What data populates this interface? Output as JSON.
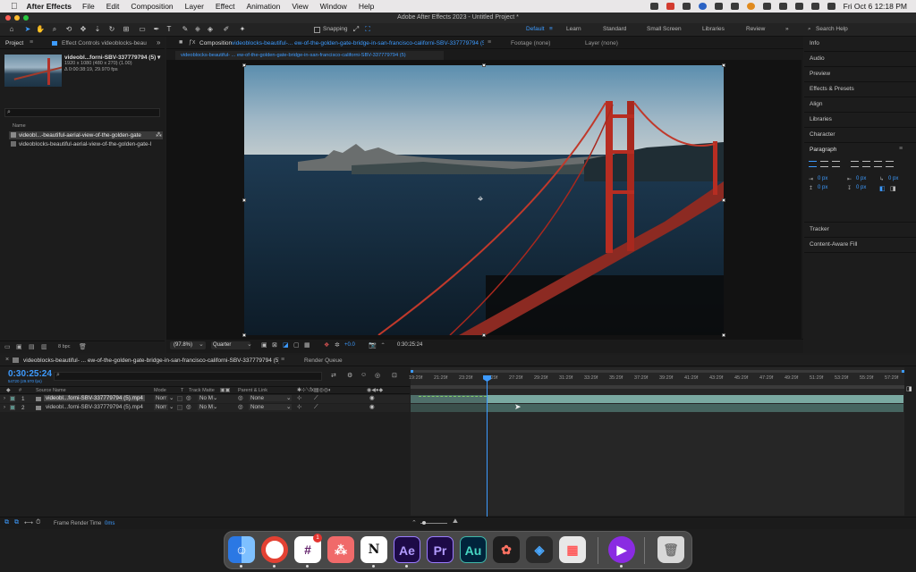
{
  "menubar": {
    "app_name": "After Effects",
    "items": [
      "File",
      "Edit",
      "Composition",
      "Layer",
      "Effect",
      "Animation",
      "View",
      "Window",
      "Help"
    ],
    "date_time": "Fri Oct 6  12:18 PM"
  },
  "window": {
    "title": "Adobe After Effects 2023 - Untitled Project *"
  },
  "toolbar": {
    "snapping_label": "Snapping",
    "workspaces": [
      "Default",
      "Learn",
      "Standard",
      "Small Screen",
      "Libraries",
      "Review"
    ],
    "active_workspace": "Default",
    "search_help_placeholder": "Search Help"
  },
  "project_panel": {
    "tab_project": "Project",
    "tab_effect_controls": "Effect Controls videoblocks-beau",
    "item_name": "videobl...forni-SBV-337779794 (5) ▾",
    "item_dims": "1920 x 1080  (480 x 270) (1.00)",
    "item_duration": "Δ 0:00:38:19, 29.970 fps",
    "name_header": "Name",
    "items": [
      "videobl...-beautiful-aerial-view-of-the-golden-gate",
      "videoblocks-beautiful-aerial-view-of-the-golden-gate-l"
    ],
    "bpc_label": "8 bpc"
  },
  "composition": {
    "tab_label": "Composition",
    "tab_name": "videoblocks-beautiful-... ew-of-the-golden-gate-bridge-in-san-francisco-californi-SBV-337779794 (5)",
    "footage_tab": "Footage (none)",
    "layer_tab": "Layer (none)",
    "breadcrumb": "videoblocks-beautiful- ... ew-of-the-golden-gate-bridge-in-san-francisco-californi-SBV-337779794 (5)",
    "zoom": "(97.8%)",
    "resolution": "Quarter",
    "exposure": "+0.0",
    "timecode": "0:30:25:24"
  },
  "right_panels": {
    "items": [
      "Info",
      "Audio",
      "Preview",
      "Effects & Presets",
      "Align",
      "Libraries",
      "Character"
    ],
    "paragraph_title": "Paragraph",
    "px_values": [
      "0 px",
      "0 px",
      "0 px",
      "0 px",
      "0 px"
    ],
    "bottom_items": [
      "Tracker",
      "Content-Aware Fill"
    ]
  },
  "timeline": {
    "tab_name": "videoblocks-beautiful- ... ew-of-the-golden-gate-bridge-in-san-francisco-californi-SBV-337779794 (5)",
    "render_queue_tab": "Render Queue",
    "current_time": "0:30:25:24",
    "frame_info": "54720 (29.970 fps)",
    "columns": {
      "source_name": "Source Name",
      "mode": "Mode",
      "t": "T",
      "track_matte": "Track Matte",
      "parent": "Parent & Link"
    },
    "layers": [
      {
        "num": "1",
        "name": "videobl...forni-SBV-337779794 (5).mp4",
        "mode": "Norr",
        "matte": "No M",
        "parent": "None"
      },
      {
        "num": "2",
        "name": "videobl...forni-SBV-337779794 (5).mp4",
        "mode": "Norr",
        "matte": "No M",
        "parent": "None"
      }
    ],
    "ruler_ticks": [
      "19:29f",
      "21:29f",
      "23:29f",
      "25:29f",
      "27:29f",
      "29:29f",
      "31:29f",
      "33:29f",
      "35:29f",
      "37:29f",
      "39:29f",
      "41:29f",
      "43:29f",
      "45:29f",
      "47:29f",
      "49:29f",
      "51:29f",
      "53:29f",
      "55:29f",
      "57:29f"
    ],
    "frame_render_label": "Frame Render Time",
    "frame_render_value": "0ms"
  },
  "dock": {
    "apps": [
      "Finder",
      "Chrome",
      "Slack",
      "Asana",
      "Notion",
      "Ae",
      "Pr",
      "Au",
      "Figma",
      "DaVinci Resolve",
      "Launchpad",
      "Screen Recorder",
      "Trash"
    ],
    "slack_badge": "1"
  },
  "colors": {
    "accent": "#3d9bff",
    "timecode": "#3d9bff",
    "layer_bar": "#5b8e87"
  }
}
